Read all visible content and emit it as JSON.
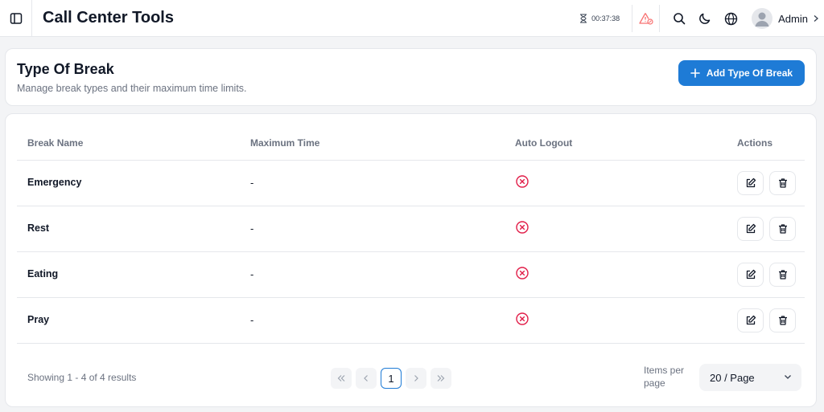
{
  "app": {
    "title": "Call Center Tools"
  },
  "topbar": {
    "timer": "00:37:38",
    "user_name": "Admin",
    "icons": [
      "sidebar-toggle-icon",
      "hourglass-icon",
      "alert-icon",
      "search-icon",
      "moon-icon",
      "globe-icon",
      "user-avatar-icon",
      "chevron-right-icon"
    ]
  },
  "page": {
    "title": "Type Of Break",
    "subtitle": "Manage break types and their maximum time limits.",
    "add_button": "Add Type Of Break"
  },
  "table": {
    "headers": {
      "name": "Break Name",
      "max_time": "Maximum Time",
      "auto_logout": "Auto Logout",
      "actions": "Actions"
    },
    "rows": [
      {
        "name": "Emergency",
        "max_time": "-",
        "auto_logout": false
      },
      {
        "name": "Rest",
        "max_time": "-",
        "auto_logout": false
      },
      {
        "name": "Eating",
        "max_time": "-",
        "auto_logout": false
      },
      {
        "name": "Pray",
        "max_time": "-",
        "auto_logout": false
      }
    ]
  },
  "pagination": {
    "info": "Showing 1 - 4 of 4 results",
    "current_page": "1",
    "items_per_page_label": "Items per page",
    "items_per_page_value": "20 / Page"
  },
  "colors": {
    "accent": "#1e7bd6",
    "danger": "#e11d48",
    "alert": "#f87171"
  }
}
